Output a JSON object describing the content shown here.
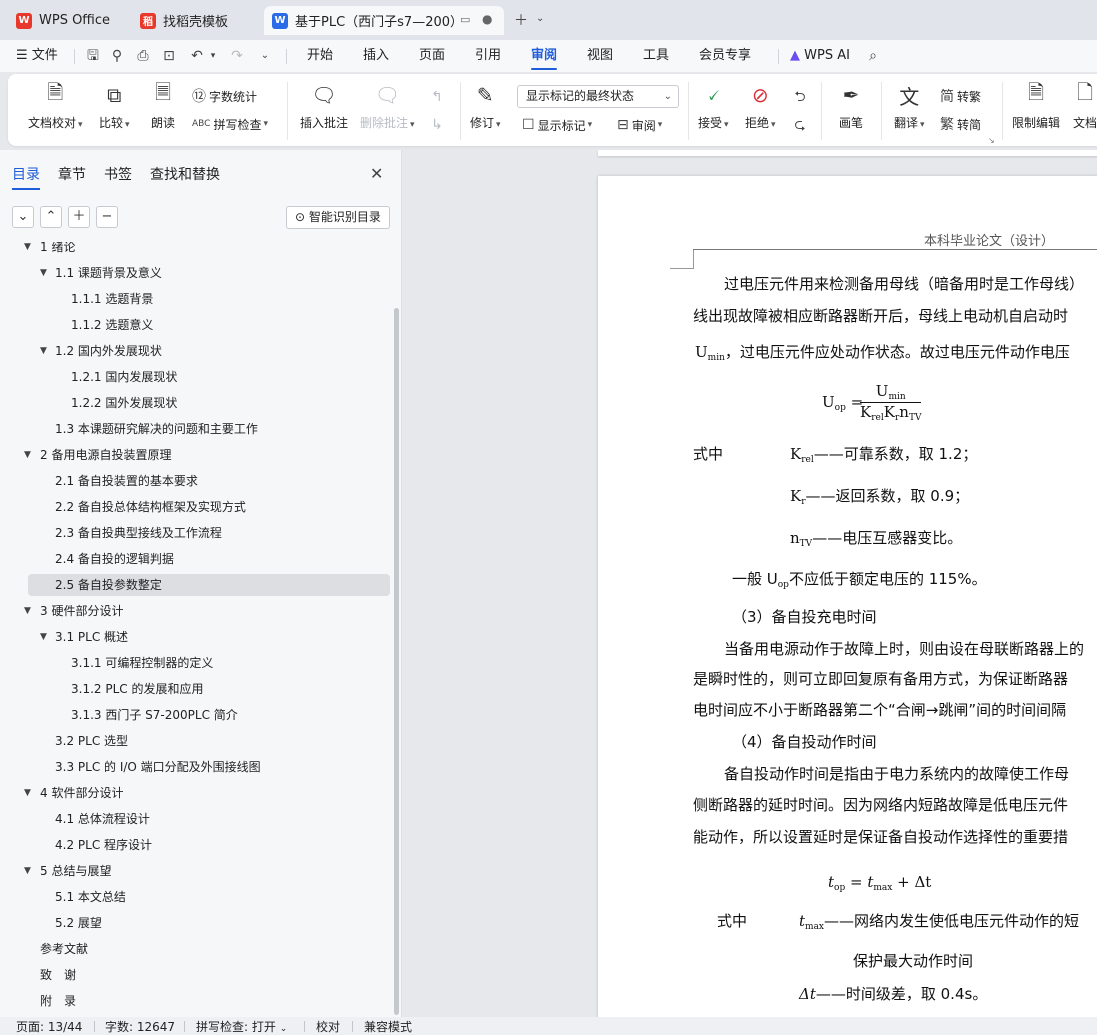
{
  "tabs": [
    {
      "label": "WPS Office",
      "icon": "wps-logo-icon",
      "color": "#e8382c"
    },
    {
      "label": "找稻壳模板",
      "icon": "docer-icon",
      "color": "#e8382c"
    },
    {
      "label": "基于PLC（西门子s7—200）的",
      "icon": "word-doc-icon",
      "color": "#2b6be8"
    }
  ],
  "menu": {
    "file": "文件",
    "items": [
      "开始",
      "插入",
      "页面",
      "引用",
      "审阅",
      "视图",
      "工具",
      "会员专享"
    ],
    "active": "审阅",
    "ai": "WPS AI"
  },
  "ribbon": {
    "doc_check": "文档校对",
    "compare": "比较",
    "read_aloud": "朗读",
    "word_count": "字数统计",
    "spell_check": "拼写检查",
    "insert_comment": "插入批注",
    "delete_comment": "删除批注",
    "track": "修订",
    "markup_state": "显示标记的最终状态",
    "show_markup": "显示标记",
    "review_pane": "审阅",
    "accept": "接受",
    "reject": "拒绝",
    "ink": "画笔",
    "translate": "翻译",
    "to_traditional": "转繁",
    "to_simplified": "转简",
    "restrict_edit": "限制编辑",
    "doc_more": "文档"
  },
  "nav": {
    "tabs": [
      "目录",
      "章节",
      "书签",
      "查找和替换"
    ],
    "smart_toc": "智能识别目录",
    "toc": [
      {
        "text": "1  绪论",
        "level": 1,
        "arrow": true
      },
      {
        "text": "1.1  课题背景及意义",
        "level": 2,
        "arrow": true
      },
      {
        "text": "1.1.1  选题背景",
        "level": 3
      },
      {
        "text": "1.1.2  选题意义",
        "level": 3
      },
      {
        "text": "1.2  国内外发展现状",
        "level": 2,
        "arrow": true
      },
      {
        "text": "1.2.1  国内发展现状",
        "level": 3
      },
      {
        "text": "1.2.2  国外发展现状",
        "level": 3
      },
      {
        "text": "1.3  本课题研究解决的问题和主要工作",
        "level": 2
      },
      {
        "text": "2  备用电源自投装置原理",
        "level": 1,
        "arrow": true
      },
      {
        "text": "2.1  备自投装置的基本要求",
        "level": 2
      },
      {
        "text": "2.2  备自投总体结构框架及实现方式",
        "level": 2
      },
      {
        "text": "2.3  备自投典型接线及工作流程",
        "level": 2
      },
      {
        "text": "2.4  备自投的逻辑判据",
        "level": 2
      },
      {
        "text": "2.5  备自投参数整定",
        "level": 2,
        "selected": true
      },
      {
        "text": "3  硬件部分设计",
        "level": 1,
        "arrow": true
      },
      {
        "text": "3.1 PLC 概述",
        "level": 2,
        "arrow": true
      },
      {
        "text": "3.1.1  可编程控制器的定义",
        "level": 3
      },
      {
        "text": "3.1.2 PLC 的发展和应用",
        "level": 3
      },
      {
        "text": "3.1.3  西门子 S7-200PLC 简介",
        "level": 3
      },
      {
        "text": "3.2 PLC 选型",
        "level": 2
      },
      {
        "text": "3.3 PLC 的 I/O 端口分配及外围接线图",
        "level": 2
      },
      {
        "text": "4  软件部分设计",
        "level": 1,
        "arrow": true
      },
      {
        "text": "4.1  总体流程设计",
        "level": 2
      },
      {
        "text": "4.2 PLC 程序设计",
        "level": 2
      },
      {
        "text": "5  总结与展望",
        "level": 1,
        "arrow": true
      },
      {
        "text": "5.1  本文总结",
        "level": 2
      },
      {
        "text": "5.2  展望",
        "level": 2
      },
      {
        "text": "参考文献",
        "level": 1
      },
      {
        "text": "致　谢",
        "level": 1
      },
      {
        "text": "附　录",
        "level": 1
      }
    ]
  },
  "document": {
    "header": "本科毕业论文（设计）",
    "p1_l1": "过电压元件用来检测备用母线（暗备用时是工作母线）",
    "p1_l2": "线出现故障被相应断路器断开后，母线上电动机自启动时",
    "p1_l3_a": "U",
    "p1_l3_sub": "min",
    "p1_l3_b": "，过电压元件应处动作状态。故过电压元件动作电压",
    "eq1_lhs": "U",
    "eq1_lhs_sub": "op",
    "eq1_num": "U",
    "eq1_num_sub": "min",
    "eq1_den": "K",
    "eq1_den_sub1": "rel",
    "eq1_den_k2": "K",
    "eq1_den_sub2": "r",
    "eq1_den_n": "n",
    "eq1_den_sub3": "TV",
    "where1": "式中",
    "def1_sym": "K",
    "def1_sub": "rel",
    "def1_text": "——可靠系数，取 1.2；",
    "def2_sym": "K",
    "def2_sub": "r",
    "def2_text": "——返回系数，取 0.9；",
    "def3_sym": "n",
    "def3_sub": "TV",
    "def3_text": "——电压互感器变比。",
    "general_a": "一般 U",
    "general_sub": "op",
    "general_b": "不应低于额定电压的 115%。",
    "h3": "（3）备自投充电时间",
    "p3_l1": "当备用电源动作于故障上时，则由设在母联断路器上的",
    "p3_l2": "是瞬时性的，则可立即回复原有备用方式，为保证断路器",
    "p3_l3": "电时间应不小于断路器第二个“合闸→跳闸”间的时间间隔",
    "h4": "（4）备自投动作时间",
    "p4_l1": "备自投动作时间是指由于电力系统内的故障使工作母",
    "p4_l2": "侧断路器的延时时间。因为网络内短路故障是低电压元件",
    "p4_l3": "能动作，所以设置延时是保证备自投动作选择性的重要措",
    "eq2_lhs": "t",
    "eq2_lhs_sub": "op",
    "eq2_rhs_t": "t",
    "eq2_rhs_sub": "max",
    "eq2_plus": " + Δt",
    "where2": "式中",
    "def4_sym": "t",
    "def4_sub": "max",
    "def4_text": "——网络内发生使低电压元件动作的短",
    "def4_cont": "保护最大动作时间",
    "def5_sym": "Δt",
    "def5_text": "——时间级差，取 0.4s。"
  },
  "status": {
    "page": "页面: 13/44",
    "words": "字数: 12647",
    "spell": "拼写检查: 打开",
    "proof": "校对",
    "compat": "兼容模式"
  }
}
